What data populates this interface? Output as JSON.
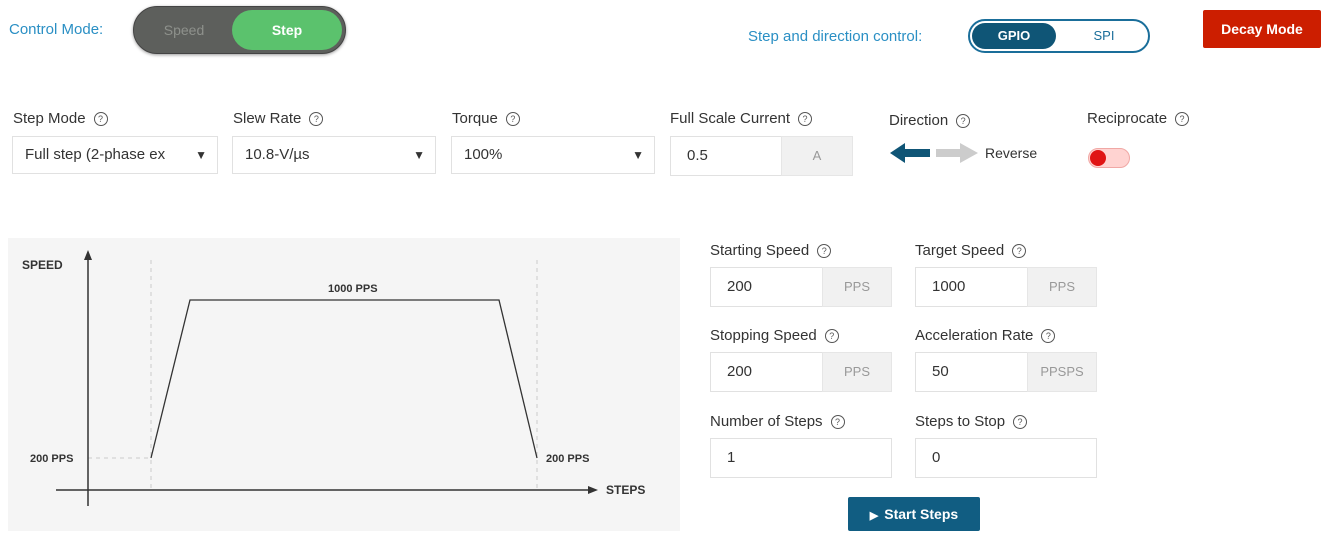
{
  "control_mode": {
    "label": "Control Mode:",
    "options": [
      "Speed",
      "Step"
    ],
    "selected": "Step"
  },
  "step_dir": {
    "label": "Step and direction control:",
    "options": [
      "GPIO",
      "SPI"
    ],
    "selected": "GPIO"
  },
  "decay_button": "Decay Mode",
  "help_glyph": "?",
  "step_mode": {
    "label": "Step Mode",
    "value": "Full step (2-phase ex"
  },
  "slew_rate": {
    "label": "Slew Rate",
    "value": "10.8-V/µs"
  },
  "torque": {
    "label": "Torque",
    "value": "100%"
  },
  "full_scale_current": {
    "label": "Full Scale Current",
    "value": "0.5",
    "unit": "A"
  },
  "direction": {
    "label": "Direction",
    "value_text": "Reverse"
  },
  "reciprocate": {
    "label": "Reciprocate",
    "state": "off"
  },
  "fields": {
    "starting_speed": {
      "label": "Starting Speed",
      "value": "200",
      "unit": "PPS"
    },
    "target_speed": {
      "label": "Target Speed",
      "value": "1000",
      "unit": "PPS"
    },
    "stopping_speed": {
      "label": "Stopping Speed",
      "value": "200",
      "unit": "PPS"
    },
    "acceleration_rate": {
      "label": "Acceleration Rate",
      "value": "50",
      "unit": "PPSPS"
    },
    "number_of_steps": {
      "label": "Number of Steps",
      "value": "1"
    },
    "steps_to_stop": {
      "label": "Steps to Stop",
      "value": "0"
    }
  },
  "start_button": "Start Steps",
  "diagram": {
    "y_axis_label": "SPEED",
    "x_axis_label": "STEPS",
    "top_label": "1000 PPS",
    "start_label": "200 PPS",
    "end_label": "200 PPS"
  },
  "colors": {
    "accent_blue": "#2a8fc4",
    "gpio_selected": "#0f5576",
    "step_green": "#5bc26d",
    "decay_red": "#cc1e00",
    "start_button": "#115d82",
    "reciprocate_knob": "#e01414"
  },
  "icons": {
    "direction_left": "arrow-left-icon",
    "direction_right": "arrow-right-icon",
    "play": "play-icon"
  }
}
